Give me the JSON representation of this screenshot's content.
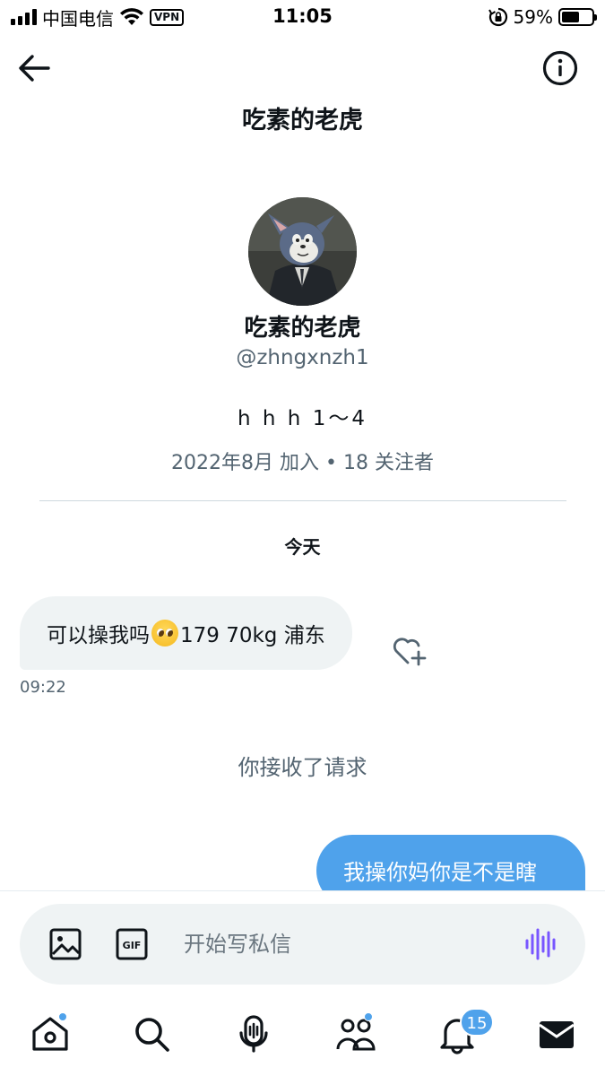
{
  "status_bar": {
    "carrier": "中国电信",
    "vpn": "VPN",
    "time": "11:05",
    "battery_percent": "59%",
    "battery_level": 0.59
  },
  "header": {
    "title": "吃素的老虎"
  },
  "profile": {
    "name": "吃素的老虎",
    "handle": "@zhngxnzh1",
    "bio": "h h h 1～4",
    "joined": "2022年8月 加入",
    "separator": " • ",
    "followers": "18 关注者"
  },
  "conversation": {
    "date_label": "今天",
    "incoming": {
      "text_before": "可以操我吗",
      "text_after": "179 70kg 浦东",
      "time": "09:22"
    },
    "system_note": "你接收了请求",
    "outgoing": {
      "text": "我操你妈你是不是瞎"
    }
  },
  "composer": {
    "placeholder": "开始写私信",
    "gif_label": "GIF"
  },
  "tabbar": {
    "notifications_badge": "15"
  },
  "colors": {
    "accent": "#4fa2eb",
    "bubble_in": "#eff3f4",
    "secondary_text": "#536471",
    "voice": "#7856ff"
  },
  "icons": [
    "arrow-left-icon",
    "info-icon",
    "heart-plus-icon",
    "image-icon",
    "gif-icon",
    "voice-waveform-icon",
    "home-icon",
    "search-icon",
    "spaces-mic-icon",
    "communities-icon",
    "bell-icon",
    "mail-icon"
  ]
}
